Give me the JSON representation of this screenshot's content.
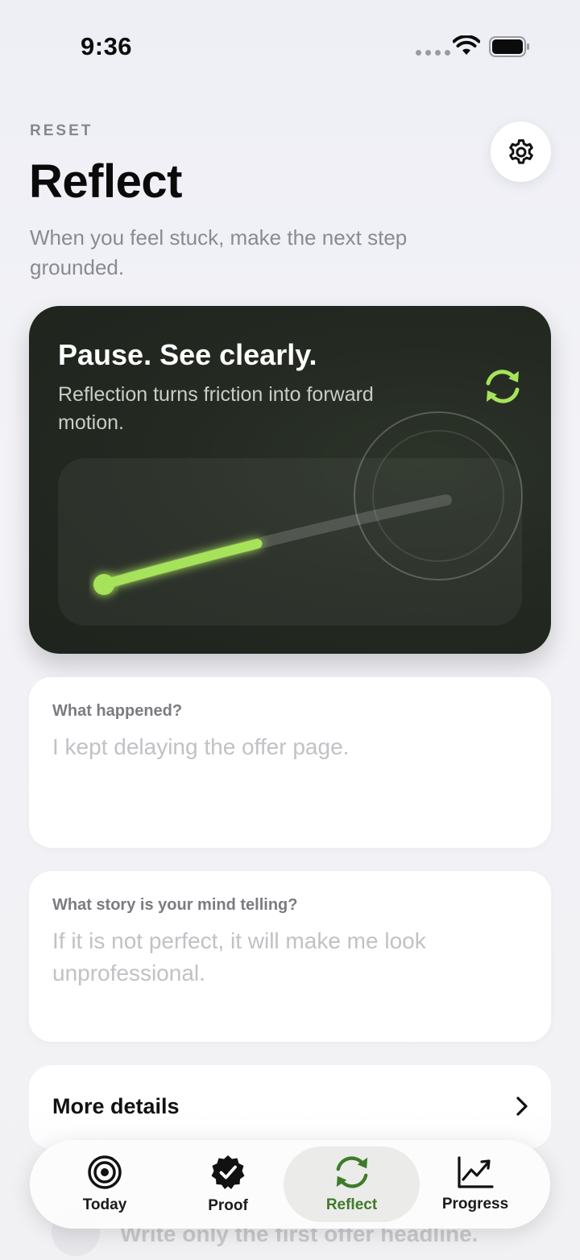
{
  "status_bar": {
    "time": "9:36"
  },
  "header": {
    "eyebrow": "RESET",
    "title": "Reflect",
    "subtitle": "When you feel stuck, make the next step grounded."
  },
  "hero": {
    "title": "Pause. See clearly.",
    "text": "Reflection turns friction into forward motion.",
    "progress": 0.45,
    "accent_color": "#a7e35a"
  },
  "entries": [
    {
      "label": "What happened?",
      "placeholder": "I kept delaying the offer page."
    },
    {
      "label": "What story is your mind telling?",
      "placeholder": "If it is not perfect, it will make me look unprofessional."
    }
  ],
  "details": {
    "label": "More details"
  },
  "behind_tab_bar": {
    "text": "Write only the first offer headline."
  },
  "tabs": [
    {
      "label": "Today",
      "icon": "target-icon",
      "active": false
    },
    {
      "label": "Proof",
      "icon": "verified-badge-icon",
      "active": false
    },
    {
      "label": "Reflect",
      "icon": "refresh-icon",
      "active": true
    },
    {
      "label": "Progress",
      "icon": "chart-line-icon",
      "active": false
    }
  ],
  "colors": {
    "active_tab": "#3f7a2a",
    "hero_bg": "#222720"
  }
}
